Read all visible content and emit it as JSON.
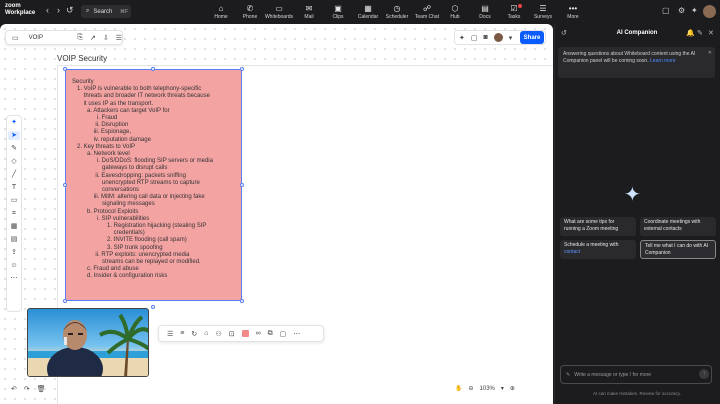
{
  "app": {
    "brand_line1": "zoom",
    "brand_line2": "Workplace"
  },
  "topbar": {
    "search_label": "Search",
    "search_shortcut": "⌘F",
    "nav": [
      "Home",
      "Phone",
      "Whiteboards",
      "Mail",
      "Clips",
      "Calendar",
      "Scheduler",
      "Team Chat",
      "Hub",
      "Docs",
      "Tasks",
      "Surveys",
      "More"
    ]
  },
  "whiteboard": {
    "name": "VOIP",
    "share_label": "Share",
    "frame_title": "VOIP Security",
    "zoom_level": "103%",
    "note_lines": [
      "Security",
      "   1. VoIP is vulnerable to both telephony-specific",
      "       threats and broader IT network threats because",
      "       it uses IP as the transport.",
      "         a. Attackers can target VoIP for",
      "               i. Fraud",
      "              ii. Disruption",
      "             iii. Espionage,",
      "             iv. reputation damage",
      "   2. Key threats to VoIP",
      "         a. Network level",
      "               i. DoS/DDoS: flooding SIP servers or media",
      "                  gateways to disrupt calls",
      "              ii. Eavesdropping: packets sniffing",
      "                  unencrypted RTP streams to capture",
      "                  conversations",
      "             iii. MitM: altering call data or injecting fake",
      "                  signaling messages",
      "         b. Protocol Exploits",
      "               i. SIP vulnerabilities",
      "                     1. Registration hijacking (stealing SIP",
      "                         credentials)",
      "                     2. INVITE flooding (call spam)",
      "                     3. SIP trunk spoofing",
      "              ii. RTP exploits: unencrypted media",
      "                  streams can be replayed or modified.",
      "         c. Fraud and abuse",
      "         d. Insider & configuration risks"
    ]
  },
  "panel": {
    "title": "AI Companion",
    "notice_text": "Answering questions about Whiteboard content using the AI Companion panel will be coming soon.",
    "notice_link": "Learn more",
    "suggestions": [
      {
        "text": "What are some tips for running a Zoom meeting"
      },
      {
        "text": "Coordinate meetings with external contacts"
      },
      {
        "text": "Schedule a meeting with",
        "tag": "contact"
      },
      {
        "text": "Tell me what I can do with AI Companion"
      }
    ],
    "input_placeholder": "Write a message or type / for more",
    "disclaimer": "AI can make mistakes. Review for accuracy."
  },
  "colors": {
    "accent": "#0b5cff",
    "note": "#f4a3a3",
    "panel_bg": "#1c1c1e"
  }
}
